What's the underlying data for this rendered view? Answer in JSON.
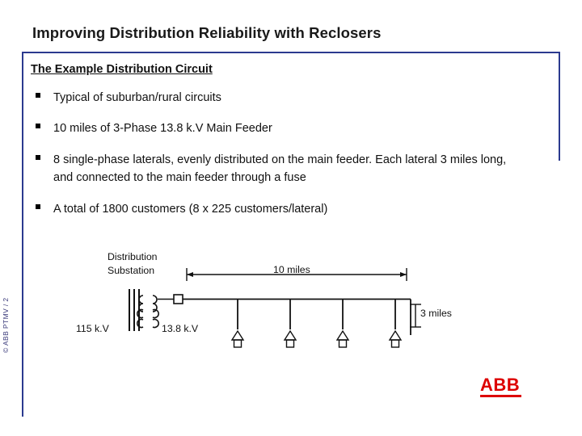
{
  "slide": {
    "title": "Improving Distribution Reliability with Reclosers",
    "subheading": "The Example Distribution Circuit",
    "bullets": [
      "Typical of suburban/rural circuits",
      "10 miles of 3-Phase 13.8 k.V Main Feeder",
      "8 single-phase laterals, evenly distributed on the main feeder. Each lateral 3 miles long, and connected to the main feeder through a fuse",
      "A total of 1800 customers (8 x 225 customers/lateral)"
    ],
    "frame_color": "#2b3a8f"
  },
  "diagram": {
    "substation_label": "Distribution\nSubstation",
    "main_span_label": "10 miles",
    "lateral_span_label": "3 miles",
    "source_voltage_label": "115 k.V",
    "feeder_voltage_label": "13.8 k.V"
  },
  "footer": {
    "vertical_code": "© ABB PTMV / 2",
    "logo_text": "ABB",
    "logo_color": "#dd0000"
  }
}
